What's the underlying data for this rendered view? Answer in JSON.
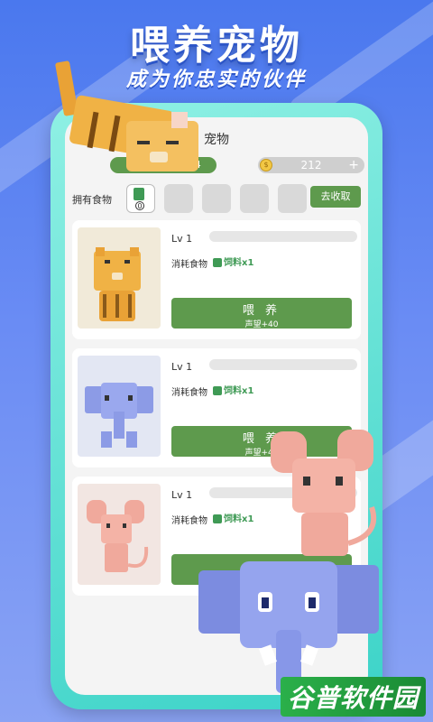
{
  "promo": {
    "headline": "喂养宠物",
    "subline": "成为你忠实的伙伴"
  },
  "screen": {
    "title": "宠物",
    "stat_value": "/4",
    "coins": "212",
    "coin_symbol": "$",
    "coin_add": "+"
  },
  "food": {
    "label": "拥有食物",
    "owned_count": "0",
    "collect_label": "去收取"
  },
  "pets": [
    {
      "name": "tiger",
      "level": "Lv 1",
      "consume_label": "消耗食物",
      "consume_item": "饲料x1",
      "feed_label": "喂 养",
      "feed_reward": "声望+40"
    },
    {
      "name": "elephant",
      "level": "Lv 1",
      "consume_label": "消耗食物",
      "consume_item": "饲料x1",
      "feed_label": "喂 养",
      "feed_reward": "声望+40"
    },
    {
      "name": "mouse",
      "level": "Lv 1",
      "consume_label": "消耗食物",
      "consume_item": "饲料x1"
    }
  ],
  "watermark": "谷普软件园",
  "colors": {
    "accent_green": "#5e9a4d",
    "frame_teal": "#3cd3c8",
    "bg_blue": "#4a78ee"
  }
}
